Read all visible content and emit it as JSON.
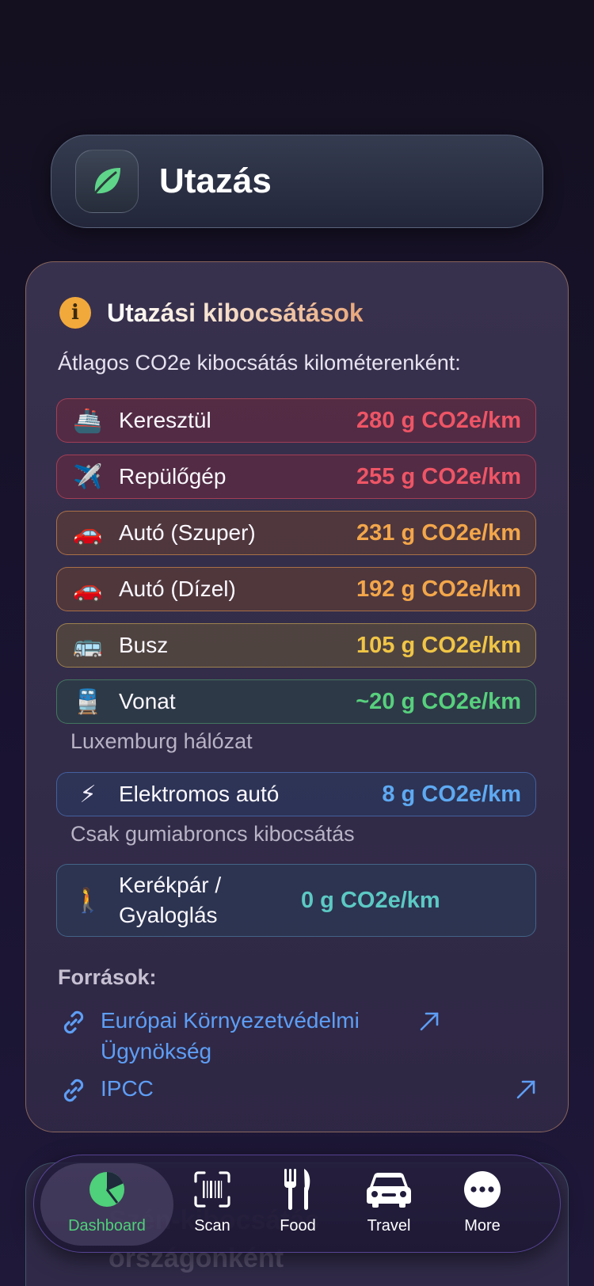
{
  "header": {
    "title": "Utazás",
    "icon": "leaf-icon"
  },
  "card": {
    "title": "Utazási kibocsátások",
    "subtitle": "Átlagos CO2e kibocsátás kilométerenként:",
    "rows": [
      {
        "emoji": "🚢",
        "icon": "ship-icon",
        "label": "Keresztül",
        "value": "280 g CO2e/km",
        "color": "#ee5566"
      },
      {
        "emoji": "✈️",
        "icon": "airplane-icon",
        "label": "Repülőgép",
        "value": "255 g CO2e/km",
        "color": "#ee5566"
      },
      {
        "emoji": "🚗",
        "icon": "car-icon",
        "label": "Autó (Szuper)",
        "value": "231 g CO2e/km",
        "color": "#f3a64a"
      },
      {
        "emoji": "🚗",
        "icon": "car-icon",
        "label": "Autó (Dízel)",
        "value": "192 g CO2e/km",
        "color": "#f3a64a"
      },
      {
        "emoji": "🚌",
        "icon": "bus-icon",
        "label": "Busz",
        "value": "105 g CO2e/km",
        "color": "#f0c546"
      },
      {
        "emoji": "🚆",
        "icon": "train-icon",
        "label": "Vonat",
        "value": "~20 g CO2e/km",
        "color": "#57d07d"
      },
      {
        "emoji": "⚡",
        "icon": "lightning-icon",
        "label": "Elektromos autó",
        "value": "8 g CO2e/km",
        "color": "#5ea9f2"
      },
      {
        "emoji": "🚶",
        "icon": "walking-icon",
        "label": "Kerékpár / Gyaloglás",
        "value": "0 g CO2e/km",
        "color": "#5cc9c4"
      }
    ],
    "notes": {
      "train": "Luxemburg hálózat",
      "ev": "Csak gumiabroncs kibocsátás"
    },
    "sources_title": "Források:",
    "sources": [
      {
        "label": "Európai Környezetvédelmi Ügynökség"
      },
      {
        "label": "IPCC"
      }
    ]
  },
  "next_card": {
    "title": "Szén-kibocsátás országonként"
  },
  "tabbar": {
    "tabs": [
      {
        "label": "Dashboard",
        "icon": "pie-chart-icon",
        "active": true
      },
      {
        "label": "Scan",
        "icon": "barcode-scan-icon"
      },
      {
        "label": "Food",
        "icon": "fork-knife-icon"
      },
      {
        "label": "Travel",
        "icon": "car-icon"
      },
      {
        "label": "More",
        "icon": "ellipsis-icon"
      }
    ],
    "active_color": "#4fd07a"
  }
}
